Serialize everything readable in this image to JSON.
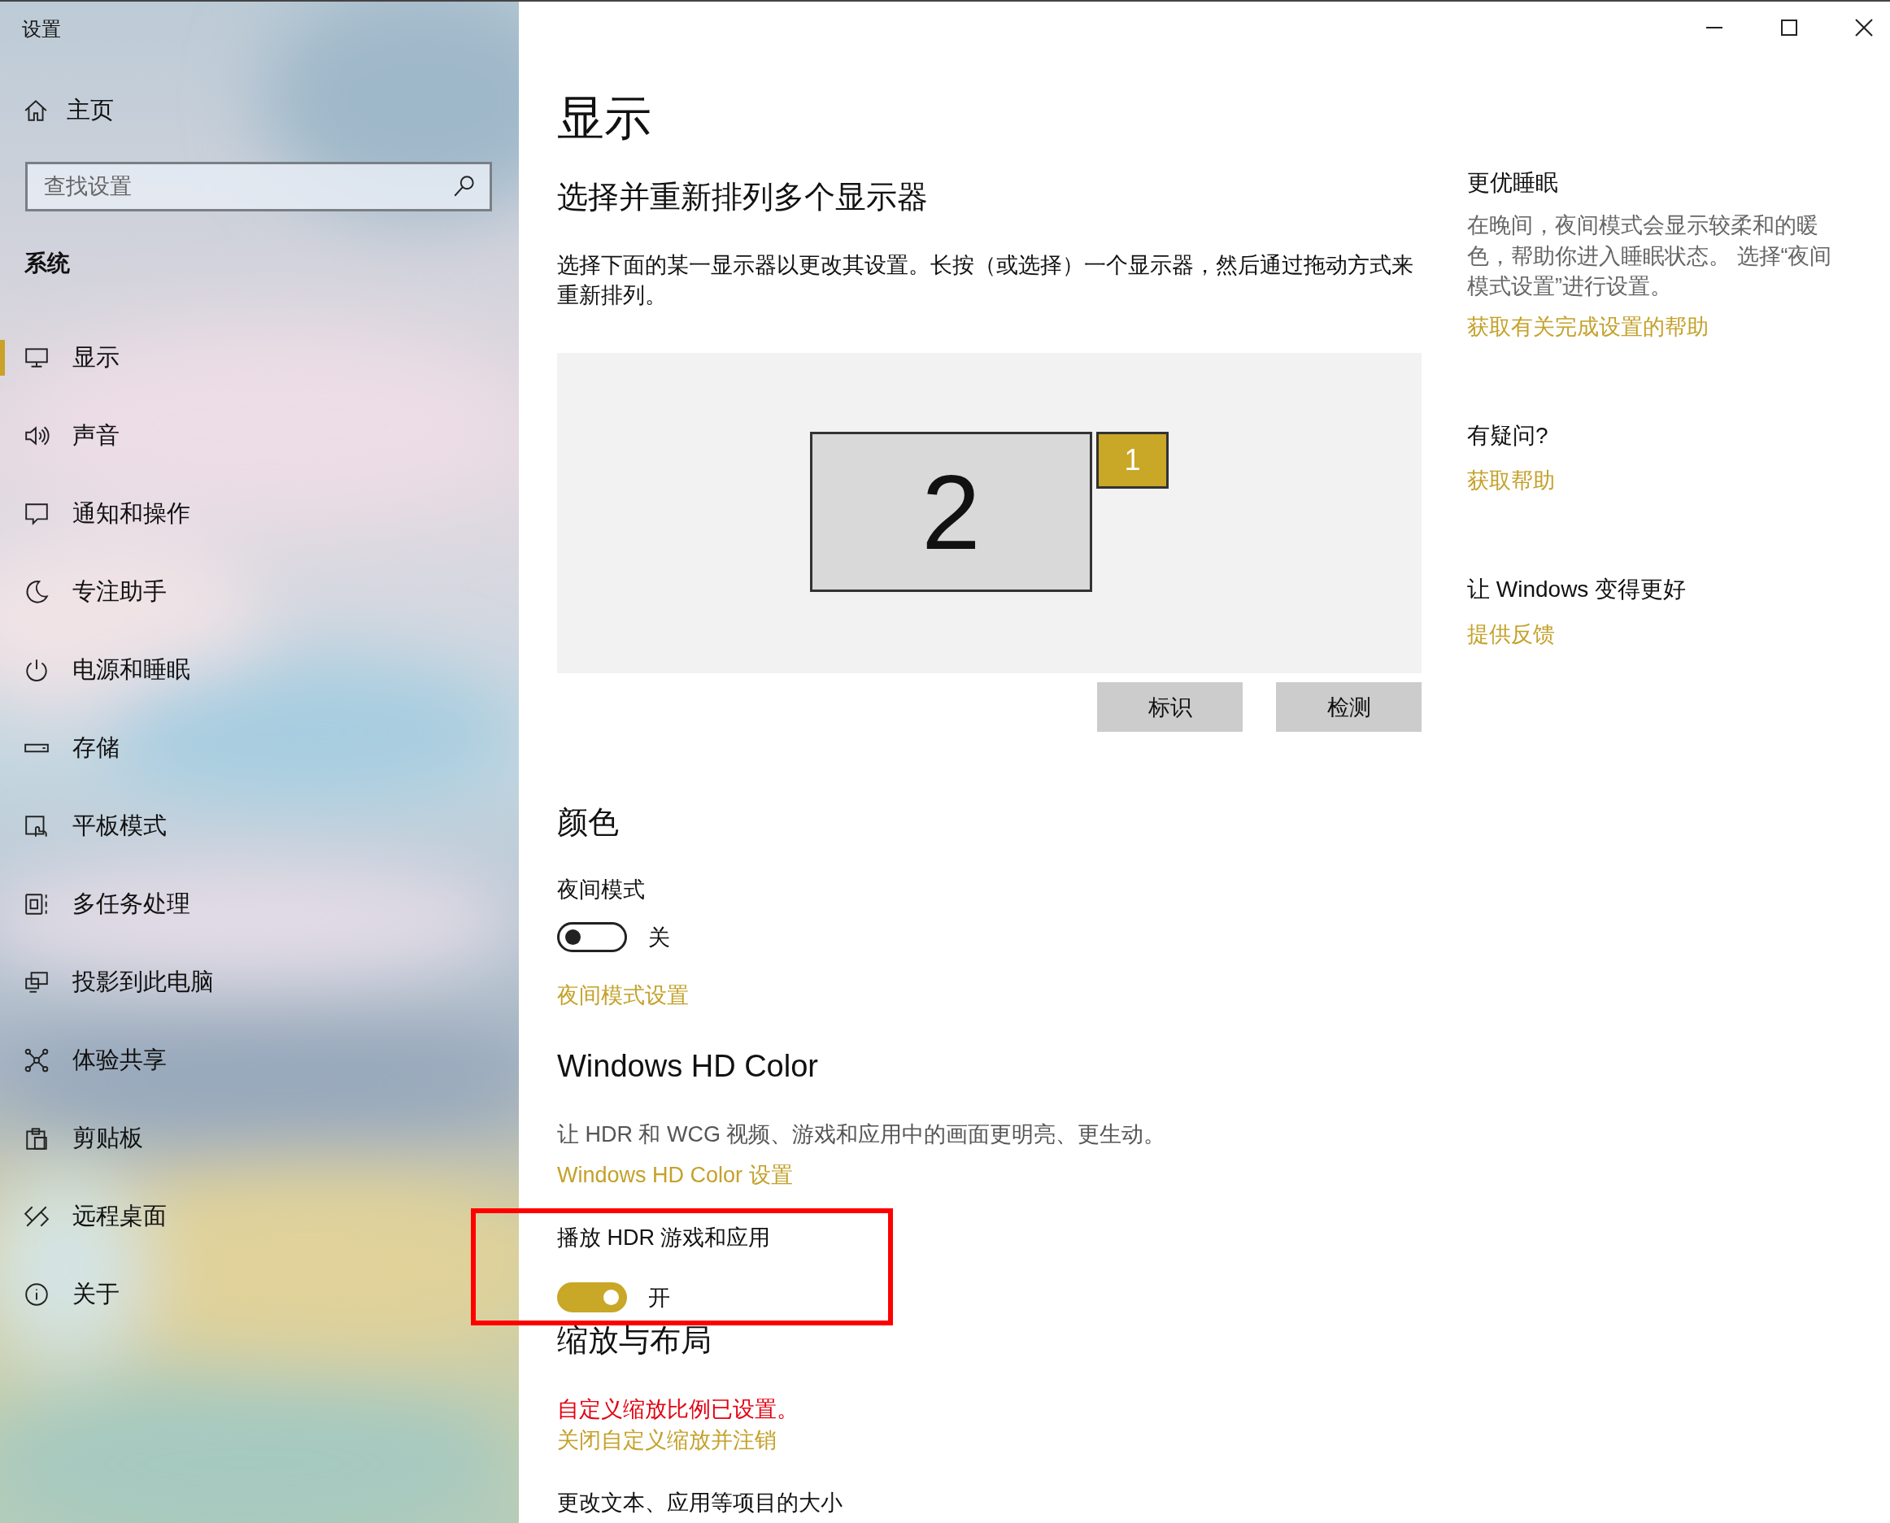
{
  "window": {
    "title": "设置"
  },
  "sidebar": {
    "home": "主页",
    "search": {
      "placeholder": "查找设置"
    },
    "section": "系统",
    "items": [
      {
        "label": "显示",
        "selected": true
      },
      {
        "label": "声音",
        "selected": false
      },
      {
        "label": "通知和操作",
        "selected": false
      },
      {
        "label": "专注助手",
        "selected": false
      },
      {
        "label": "电源和睡眠",
        "selected": false
      },
      {
        "label": "存储",
        "selected": false
      },
      {
        "label": "平板模式",
        "selected": false
      },
      {
        "label": "多任务处理",
        "selected": false
      },
      {
        "label": "投影到此电脑",
        "selected": false
      },
      {
        "label": "体验共享",
        "selected": false
      },
      {
        "label": "剪贴板",
        "selected": false
      },
      {
        "label": "远程桌面",
        "selected": false
      },
      {
        "label": "关于",
        "selected": false
      }
    ]
  },
  "page": {
    "title": "显示",
    "arrange": {
      "heading": "选择并重新排列多个显示器",
      "description": "选择下面的某一显示器以更改其设置。长按（或选择）一个显示器，然后通过拖动方式来重新排列。",
      "displays": [
        {
          "label": "2",
          "selected": false
        },
        {
          "label": "1",
          "selected": true
        }
      ],
      "buttons": [
        "标识",
        "检测"
      ]
    },
    "color": {
      "heading": "颜色",
      "night_light": {
        "label": "夜间模式",
        "on": false,
        "state_text": "关"
      },
      "link": "夜间模式设置"
    },
    "hd_color": {
      "heading": "Windows HD Color",
      "description": "让 HDR 和 WCG 视频、游戏和应用中的画面更明亮、更生动。",
      "link": "Windows HD Color 设置",
      "play_hdr": {
        "label": "播放 HDR 游戏和应用",
        "on": true,
        "state_text": "开"
      }
    },
    "scale": {
      "heading": "缩放与布局",
      "warning": "自定义缩放比例已设置。",
      "link": "关闭自定义缩放并注销",
      "option_label": "更改文本、应用等项目的大小"
    }
  },
  "aside": [
    {
      "heading": "更优睡眠",
      "text": "在晚间，夜间模式会显示较柔和的暖色，帮助你进入睡眠状态。 选择“夜间模式设置”进行设置。",
      "link": "获取有关完成设置的帮助"
    },
    {
      "heading": "有疑问?",
      "link": "获取帮助"
    },
    {
      "heading": "让 Windows 变得更好",
      "link": "提供反馈"
    }
  ]
}
